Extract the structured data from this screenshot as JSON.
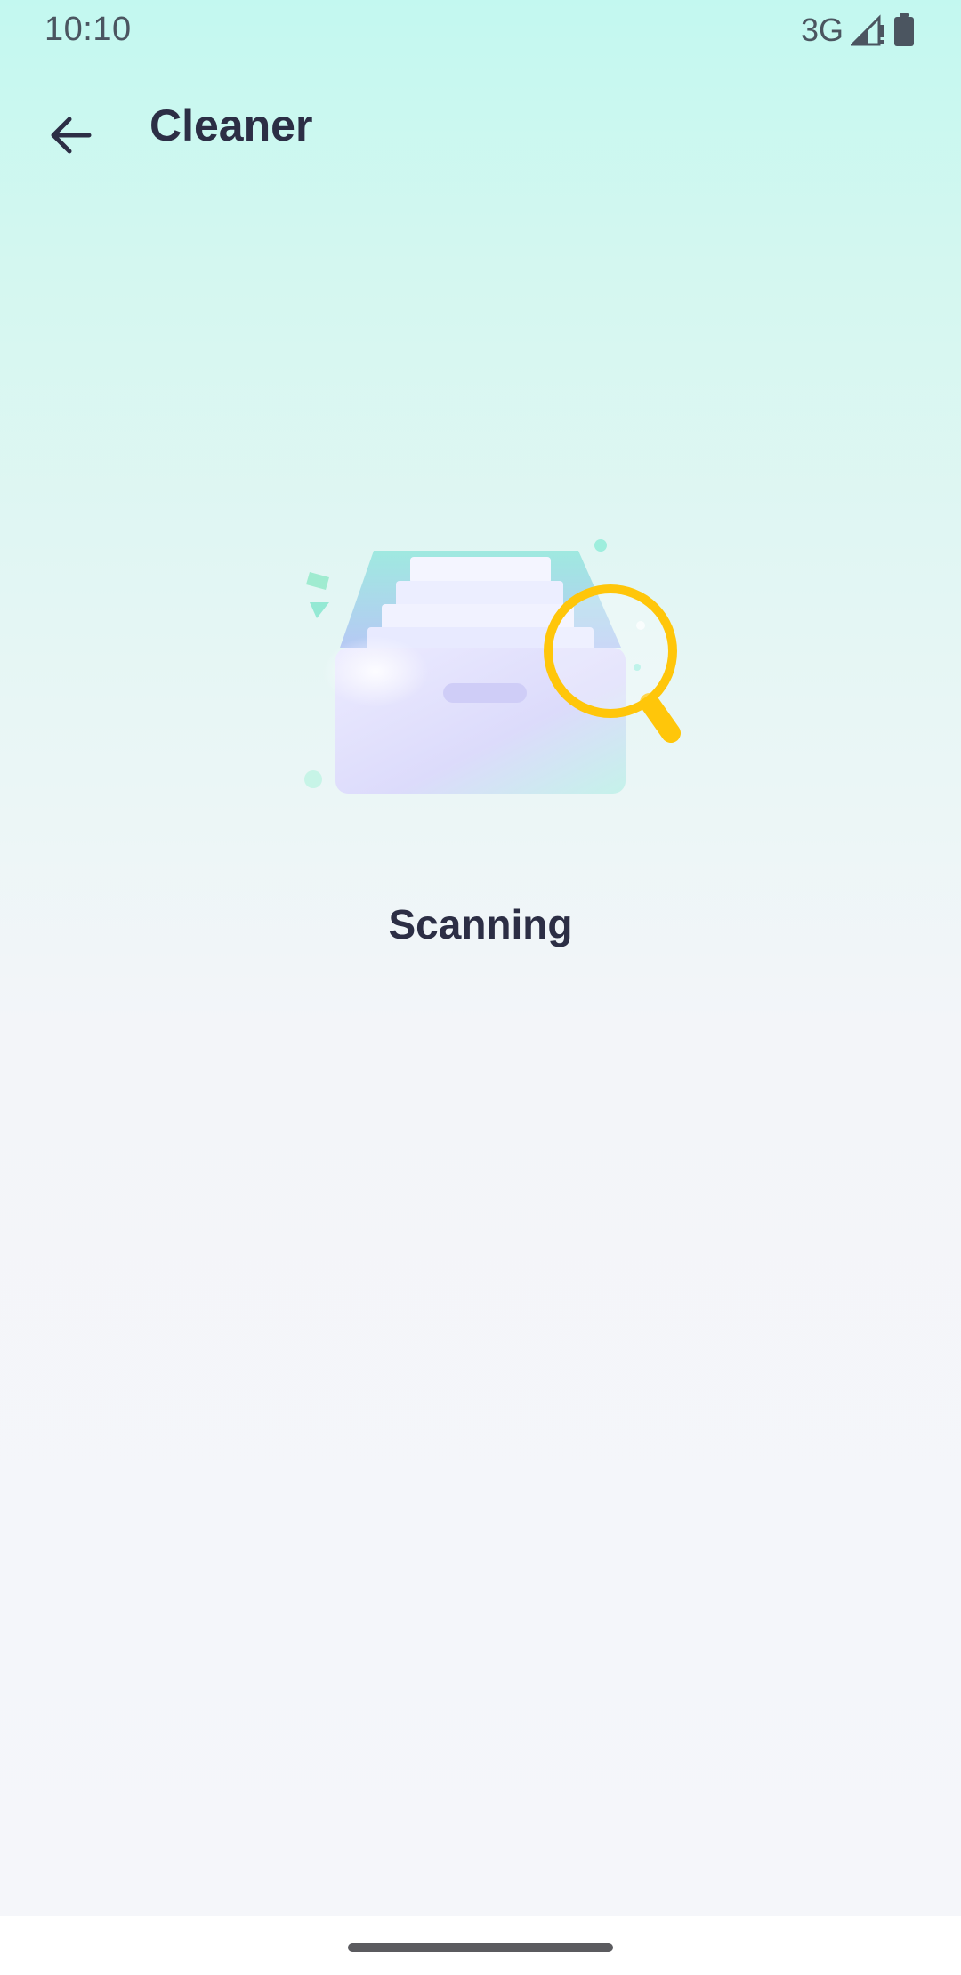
{
  "status_bar": {
    "time": "10:10",
    "network": "3G",
    "icons": [
      "signal-icon",
      "battery-icon"
    ]
  },
  "app_bar": {
    "back_icon": "arrow-left-icon",
    "title": "Cleaner"
  },
  "illustration": {
    "description_icon": "file-drawer-magnifier-icon"
  },
  "scan": {
    "status": "Scanning"
  },
  "colors": {
    "title_text": "#2c2e45",
    "gradient_top": "#c3f8f0",
    "background": "#f5f6fa",
    "magnifier": "#ffc60a",
    "accent_mint": "#7fe6cc"
  }
}
